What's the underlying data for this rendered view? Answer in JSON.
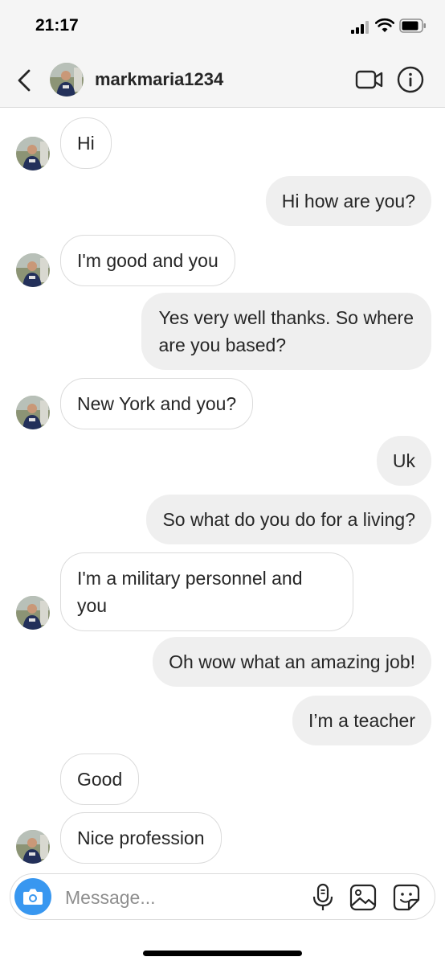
{
  "status": {
    "time": "21:17"
  },
  "header": {
    "username": "markmaria1234"
  },
  "messages": [
    {
      "text": "Hi",
      "direction": "in"
    },
    {
      "text": "Hi how are you?",
      "direction": "out"
    },
    {
      "text": "I'm good and you",
      "direction": "in"
    },
    {
      "text": "Yes very well thanks. So where\nare you based?",
      "direction": "out"
    },
    {
      "text": "New York and you?",
      "direction": "in"
    },
    {
      "text": "Uk",
      "direction": "out"
    },
    {
      "text": "So what do you do for a living?",
      "direction": "out"
    },
    {
      "text": "I'm a military personnel and\nyou",
      "direction": "in"
    },
    {
      "text": "Oh wow what an amazing job!",
      "direction": "out"
    },
    {
      "text": "I’m a teacher",
      "direction": "out"
    },
    {
      "text": "Good",
      "direction": "in"
    },
    {
      "text": "Nice profession",
      "direction": "in"
    }
  ],
  "composer": {
    "placeholder": "Message..."
  },
  "icons": {
    "back": "chevron-left-icon",
    "video": "video-camera-icon",
    "info": "info-icon",
    "camera": "camera-icon",
    "mic": "microphone-icon",
    "gallery": "image-icon",
    "sticker": "sticker-icon"
  },
  "colors": {
    "accent": "#3897f0",
    "outgoing_bubble": "#efefef",
    "incoming_border": "#dbdbdb"
  }
}
